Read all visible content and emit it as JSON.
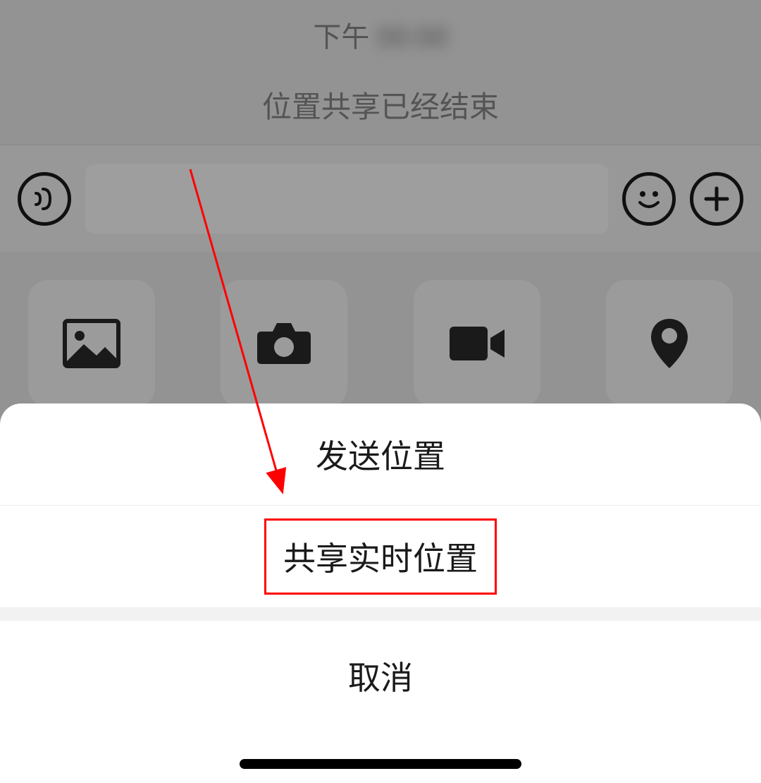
{
  "chat": {
    "timestamp_prefix": "下午",
    "timestamp_blurred": "00:00",
    "status_message": "位置共享已经结束"
  },
  "attach_tiles": {
    "photo": "photo-icon",
    "camera": "camera-icon",
    "video": "video-call-icon",
    "location": "location-icon"
  },
  "action_sheet": {
    "option_send_location": "发送位置",
    "option_share_realtime": "共享实时位置",
    "cancel": "取消"
  }
}
